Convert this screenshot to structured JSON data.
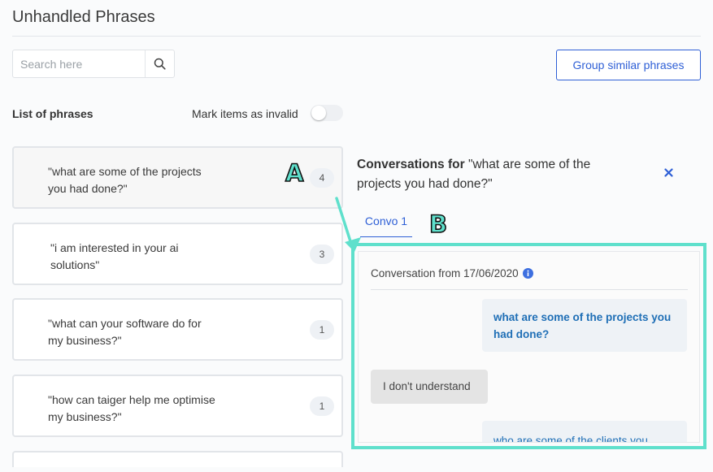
{
  "page": {
    "title": "Unhandled Phrases"
  },
  "search": {
    "placeholder": "Search here",
    "value": "",
    "icon": "search-icon"
  },
  "toolbar": {
    "group_label": "Group similar phrases"
  },
  "list": {
    "heading": "List of phrases",
    "mark_invalid_label": "Mark items as invalid",
    "mark_invalid_on": false,
    "items": [
      {
        "text": "\"what are some of the projects you had done?\"",
        "count": "4",
        "active": true
      },
      {
        "text": "\"i am interested in your ai solutions\"",
        "count": "3",
        "active": false
      },
      {
        "text": "\"what can your software do for my business?\"",
        "count": "1",
        "active": false
      },
      {
        "text": "\"how can taiger help me optimise my business?\"",
        "count": "1",
        "active": false
      }
    ]
  },
  "conversation": {
    "title_prefix": "Conversations for",
    "title_phrase": "\"what are some of the projects you had done?\"",
    "close_icon": "close-icon",
    "tabs": [
      {
        "label": "Convo 1",
        "active": true
      }
    ],
    "header": "Conversation from 17/06/2020",
    "info_icon": "info-icon",
    "messages": [
      {
        "from": "user",
        "text": "what are some of the projects you had done?"
      },
      {
        "from": "bot",
        "text": "I don't understand"
      },
      {
        "from": "user",
        "text": "who are some of the clients you"
      }
    ]
  },
  "annotations": {
    "a": "A",
    "b": "B"
  },
  "colors": {
    "accent": "#2e5fd6",
    "highlight": "#5fe0cc",
    "user_text": "#1f6fb6"
  }
}
